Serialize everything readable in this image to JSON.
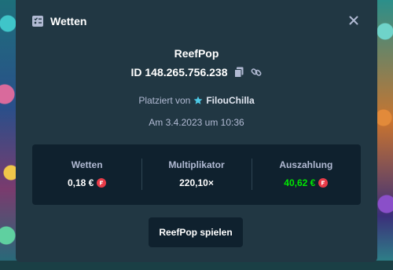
{
  "modal": {
    "title": "Wetten",
    "close_icon": "close-icon",
    "header_icon": "bet-slip-icon"
  },
  "bet": {
    "game_name": "ReefPop",
    "id": "ID 148.265.756.238",
    "placed_by_label": "Platziert von",
    "player": "FilouChilla",
    "date": "Am 3.4.2023 um 10:36"
  },
  "stats": {
    "bet_label": "Wetten",
    "bet_value": "0,18 €",
    "multiplier_label": "Multiplikator",
    "multiplier_value": "220,10×",
    "payout_label": "Auszahlung",
    "payout_value": "40,62 €"
  },
  "actions": {
    "play_label": "ReefPop spielen"
  },
  "colors": {
    "modal_bg": "#213743",
    "panel_bg": "#0f212e",
    "payout_green": "#00e701",
    "coin_red": "#e83b48"
  }
}
